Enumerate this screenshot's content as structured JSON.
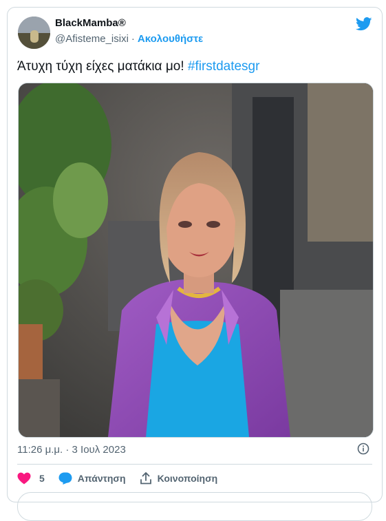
{
  "author": {
    "name": "BlackMamba®",
    "handle": "@Afisteme_isixi",
    "separator": "·",
    "follow_label": "Ακολουθήστε"
  },
  "tweet": {
    "text": "Άτυχη τύχη είχες ματάκια μο!",
    "hashtag": "#firstdatesgr",
    "timestamp": "11:26 μ.μ. · 3 Ιουλ 2023"
  },
  "actions": {
    "like_count": "5",
    "reply_label": "Απάντηση",
    "share_label": "Κοινοποίηση"
  },
  "icons": {
    "brand": "twitter-bird-icon",
    "info": "info-icon",
    "like": "heart-icon",
    "reply": "speech-bubble-icon",
    "share": "share-upload-icon"
  },
  "colors": {
    "accent": "#1d9bf0",
    "like": "#f91880",
    "text": "#0f1419",
    "muted": "#536471"
  }
}
